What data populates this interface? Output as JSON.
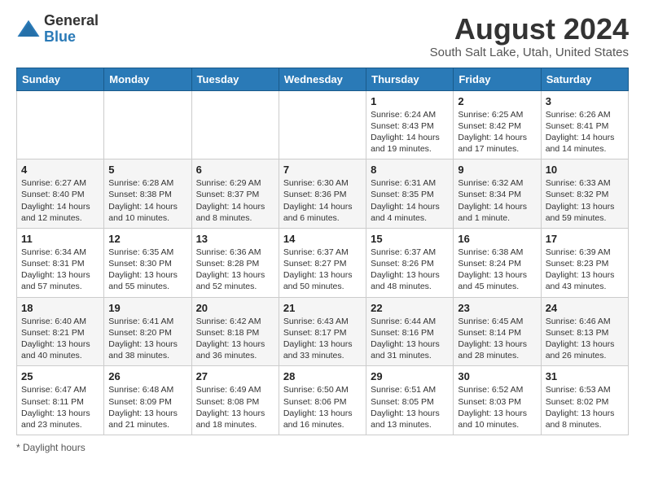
{
  "header": {
    "logo_general": "General",
    "logo_blue": "Blue",
    "month_year": "August 2024",
    "location": "South Salt Lake, Utah, United States"
  },
  "days_of_week": [
    "Sunday",
    "Monday",
    "Tuesday",
    "Wednesday",
    "Thursday",
    "Friday",
    "Saturday"
  ],
  "weeks": [
    [
      {
        "day": "",
        "info": ""
      },
      {
        "day": "",
        "info": ""
      },
      {
        "day": "",
        "info": ""
      },
      {
        "day": "",
        "info": ""
      },
      {
        "day": "1",
        "info": "Sunrise: 6:24 AM\nSunset: 8:43 PM\nDaylight: 14 hours\nand 19 minutes."
      },
      {
        "day": "2",
        "info": "Sunrise: 6:25 AM\nSunset: 8:42 PM\nDaylight: 14 hours\nand 17 minutes."
      },
      {
        "day": "3",
        "info": "Sunrise: 6:26 AM\nSunset: 8:41 PM\nDaylight: 14 hours\nand 14 minutes."
      }
    ],
    [
      {
        "day": "4",
        "info": "Sunrise: 6:27 AM\nSunset: 8:40 PM\nDaylight: 14 hours\nand 12 minutes."
      },
      {
        "day": "5",
        "info": "Sunrise: 6:28 AM\nSunset: 8:38 PM\nDaylight: 14 hours\nand 10 minutes."
      },
      {
        "day": "6",
        "info": "Sunrise: 6:29 AM\nSunset: 8:37 PM\nDaylight: 14 hours\nand 8 minutes."
      },
      {
        "day": "7",
        "info": "Sunrise: 6:30 AM\nSunset: 8:36 PM\nDaylight: 14 hours\nand 6 minutes."
      },
      {
        "day": "8",
        "info": "Sunrise: 6:31 AM\nSunset: 8:35 PM\nDaylight: 14 hours\nand 4 minutes."
      },
      {
        "day": "9",
        "info": "Sunrise: 6:32 AM\nSunset: 8:34 PM\nDaylight: 14 hours\nand 1 minute."
      },
      {
        "day": "10",
        "info": "Sunrise: 6:33 AM\nSunset: 8:32 PM\nDaylight: 13 hours\nand 59 minutes."
      }
    ],
    [
      {
        "day": "11",
        "info": "Sunrise: 6:34 AM\nSunset: 8:31 PM\nDaylight: 13 hours\nand 57 minutes."
      },
      {
        "day": "12",
        "info": "Sunrise: 6:35 AM\nSunset: 8:30 PM\nDaylight: 13 hours\nand 55 minutes."
      },
      {
        "day": "13",
        "info": "Sunrise: 6:36 AM\nSunset: 8:28 PM\nDaylight: 13 hours\nand 52 minutes."
      },
      {
        "day": "14",
        "info": "Sunrise: 6:37 AM\nSunset: 8:27 PM\nDaylight: 13 hours\nand 50 minutes."
      },
      {
        "day": "15",
        "info": "Sunrise: 6:37 AM\nSunset: 8:26 PM\nDaylight: 13 hours\nand 48 minutes."
      },
      {
        "day": "16",
        "info": "Sunrise: 6:38 AM\nSunset: 8:24 PM\nDaylight: 13 hours\nand 45 minutes."
      },
      {
        "day": "17",
        "info": "Sunrise: 6:39 AM\nSunset: 8:23 PM\nDaylight: 13 hours\nand 43 minutes."
      }
    ],
    [
      {
        "day": "18",
        "info": "Sunrise: 6:40 AM\nSunset: 8:21 PM\nDaylight: 13 hours\nand 40 minutes."
      },
      {
        "day": "19",
        "info": "Sunrise: 6:41 AM\nSunset: 8:20 PM\nDaylight: 13 hours\nand 38 minutes."
      },
      {
        "day": "20",
        "info": "Sunrise: 6:42 AM\nSunset: 8:18 PM\nDaylight: 13 hours\nand 36 minutes."
      },
      {
        "day": "21",
        "info": "Sunrise: 6:43 AM\nSunset: 8:17 PM\nDaylight: 13 hours\nand 33 minutes."
      },
      {
        "day": "22",
        "info": "Sunrise: 6:44 AM\nSunset: 8:16 PM\nDaylight: 13 hours\nand 31 minutes."
      },
      {
        "day": "23",
        "info": "Sunrise: 6:45 AM\nSunset: 8:14 PM\nDaylight: 13 hours\nand 28 minutes."
      },
      {
        "day": "24",
        "info": "Sunrise: 6:46 AM\nSunset: 8:13 PM\nDaylight: 13 hours\nand 26 minutes."
      }
    ],
    [
      {
        "day": "25",
        "info": "Sunrise: 6:47 AM\nSunset: 8:11 PM\nDaylight: 13 hours\nand 23 minutes."
      },
      {
        "day": "26",
        "info": "Sunrise: 6:48 AM\nSunset: 8:09 PM\nDaylight: 13 hours\nand 21 minutes."
      },
      {
        "day": "27",
        "info": "Sunrise: 6:49 AM\nSunset: 8:08 PM\nDaylight: 13 hours\nand 18 minutes."
      },
      {
        "day": "28",
        "info": "Sunrise: 6:50 AM\nSunset: 8:06 PM\nDaylight: 13 hours\nand 16 minutes."
      },
      {
        "day": "29",
        "info": "Sunrise: 6:51 AM\nSunset: 8:05 PM\nDaylight: 13 hours\nand 13 minutes."
      },
      {
        "day": "30",
        "info": "Sunrise: 6:52 AM\nSunset: 8:03 PM\nDaylight: 13 hours\nand 10 minutes."
      },
      {
        "day": "31",
        "info": "Sunrise: 6:53 AM\nSunset: 8:02 PM\nDaylight: 13 hours\nand 8 minutes."
      }
    ]
  ],
  "footer": {
    "note": "Daylight hours"
  }
}
